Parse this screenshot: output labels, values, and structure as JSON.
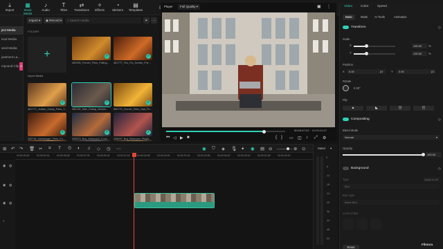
{
  "top_tabs": [
    {
      "label": "Import",
      "icon": "import-icon",
      "active": false
    },
    {
      "label": "Stock Media",
      "icon": "stock-media-icon",
      "active": true
    },
    {
      "label": "Audio",
      "icon": "audio-icon",
      "active": false
    },
    {
      "label": "Titles",
      "icon": "titles-icon",
      "active": false
    },
    {
      "label": "Transitions",
      "icon": "transitions-icon",
      "active": false
    },
    {
      "label": "Effects",
      "icon": "effects-icon",
      "active": false
    },
    {
      "label": "Stickers",
      "icon": "stickers-icon",
      "active": false
    },
    {
      "label": "Templates",
      "icon": "templates-icon",
      "active": false
    }
  ],
  "left_nav": [
    {
      "label": "ject Media",
      "active": true
    },
    {
      "label": "loud Media",
      "active": false
    },
    {
      "label": "ared Media",
      "active": false
    },
    {
      "label": "justment La...",
      "active": false
    },
    {
      "label": "mpound Clip",
      "active": false,
      "badge": "N"
    }
  ],
  "media_toolbar": {
    "import": "Import",
    "record": "Record",
    "search_placeholder": "Search media"
  },
  "media": {
    "folder_label": "FOLDER",
    "import_label": "Import Media",
    "items": [
      {
        "caption": "462905_French_Fries_Falling...",
        "checked": true,
        "selected": false
      },
      {
        "caption": "461777_Tee_Fol_Jordan_Frie...",
        "checked": true,
        "selected": false
      },
      {
        "caption": "461777_Jordan_Camp_Fries_T...",
        "checked": true,
        "selected": false
      },
      {
        "caption": "382232_Man_Eating_Workin...",
        "checked": true,
        "selected": true
      },
      {
        "caption": "560772_French_Fries_Salt_Fri...",
        "checked": true,
        "selected": false
      },
      {
        "caption": "335734_Hamburger_Fries_Fo...",
        "checked": true,
        "selected": false
      },
      {
        "caption": "333573_Boy_Astronaut_Cook...",
        "checked": true,
        "selected": false
      },
      {
        "caption": "228097_Boy_Bedroom_Playin...",
        "checked": true,
        "selected": false
      },
      {
        "caption": "",
        "checked": false,
        "selected": false
      },
      {
        "caption": "",
        "checked": false,
        "selected": false
      },
      {
        "caption": "",
        "checked": false,
        "selected": false
      }
    ]
  },
  "player": {
    "label": "Player",
    "quality": "Full Quality",
    "current_time": "00:03:47:12",
    "total_time": "00:00:04:07",
    "progress": 0.82
  },
  "inspector": {
    "tabs": [
      "Video",
      "Color",
      "Speed"
    ],
    "active_tab": "Video",
    "subtabs": [
      "Basic",
      "Mask",
      "AI Tools",
      "Animation"
    ],
    "active_subtab": "Basic",
    "transform_label": "Transform",
    "scale_label": "Scale",
    "scale_x_label": "X",
    "scale_y_label": "Y",
    "scale_x": "100.00",
    "scale_y": "100.00",
    "percent": "%",
    "scale_level": 1.0,
    "position_label": "Position",
    "pos_x_label": "X",
    "pos_x": "0.00",
    "pos_y_label": "Y",
    "pos_y": "0.00",
    "px": "px",
    "rotate_label": "Rotate",
    "rotate": "0.00°",
    "flip_label": "Flip",
    "compositing_label": "Compositing",
    "blend_mode_label": "Blend Mode",
    "blend_mode": "Normal",
    "opacity_label": "Opacity",
    "opacity": "100.00",
    "opacity_level": 1.0,
    "background_label": "Background",
    "bg_type_label": "Type",
    "bg_type": "Blur",
    "bg_blur_style_label": "Blur style",
    "bg_blur_style": "Basic Blur",
    "bg_blur_level_label": "Level of blur",
    "apply_all": "Apply to All",
    "reset_label": "Reset",
    "watermark": "Filmora"
  },
  "timeline": {
    "ruler_times": [
      "00:00:00:00",
      "00:00:02:16",
      "00:00:05:08",
      "00:00:07:00",
      "00:00:09:24",
      "00:00:12:16",
      "00:00:15:08",
      "00:00:18:00",
      "00:00:20:16",
      "00:00:23:08",
      "00:00:26:00",
      "00:00:28:16",
      "00:00:31:08",
      "00:00:34:00"
    ],
    "meter_label": "Meter",
    "meter_scale": [
      "0",
      "-6",
      "-12",
      "-18",
      "-24",
      "-30",
      "-36",
      "-42",
      "-48",
      "-54"
    ]
  },
  "colors": {
    "accent": "#2fd1b7",
    "playhead": "#e4453a",
    "badge": "#e03c7b",
    "clip": "#2c8f77"
  }
}
